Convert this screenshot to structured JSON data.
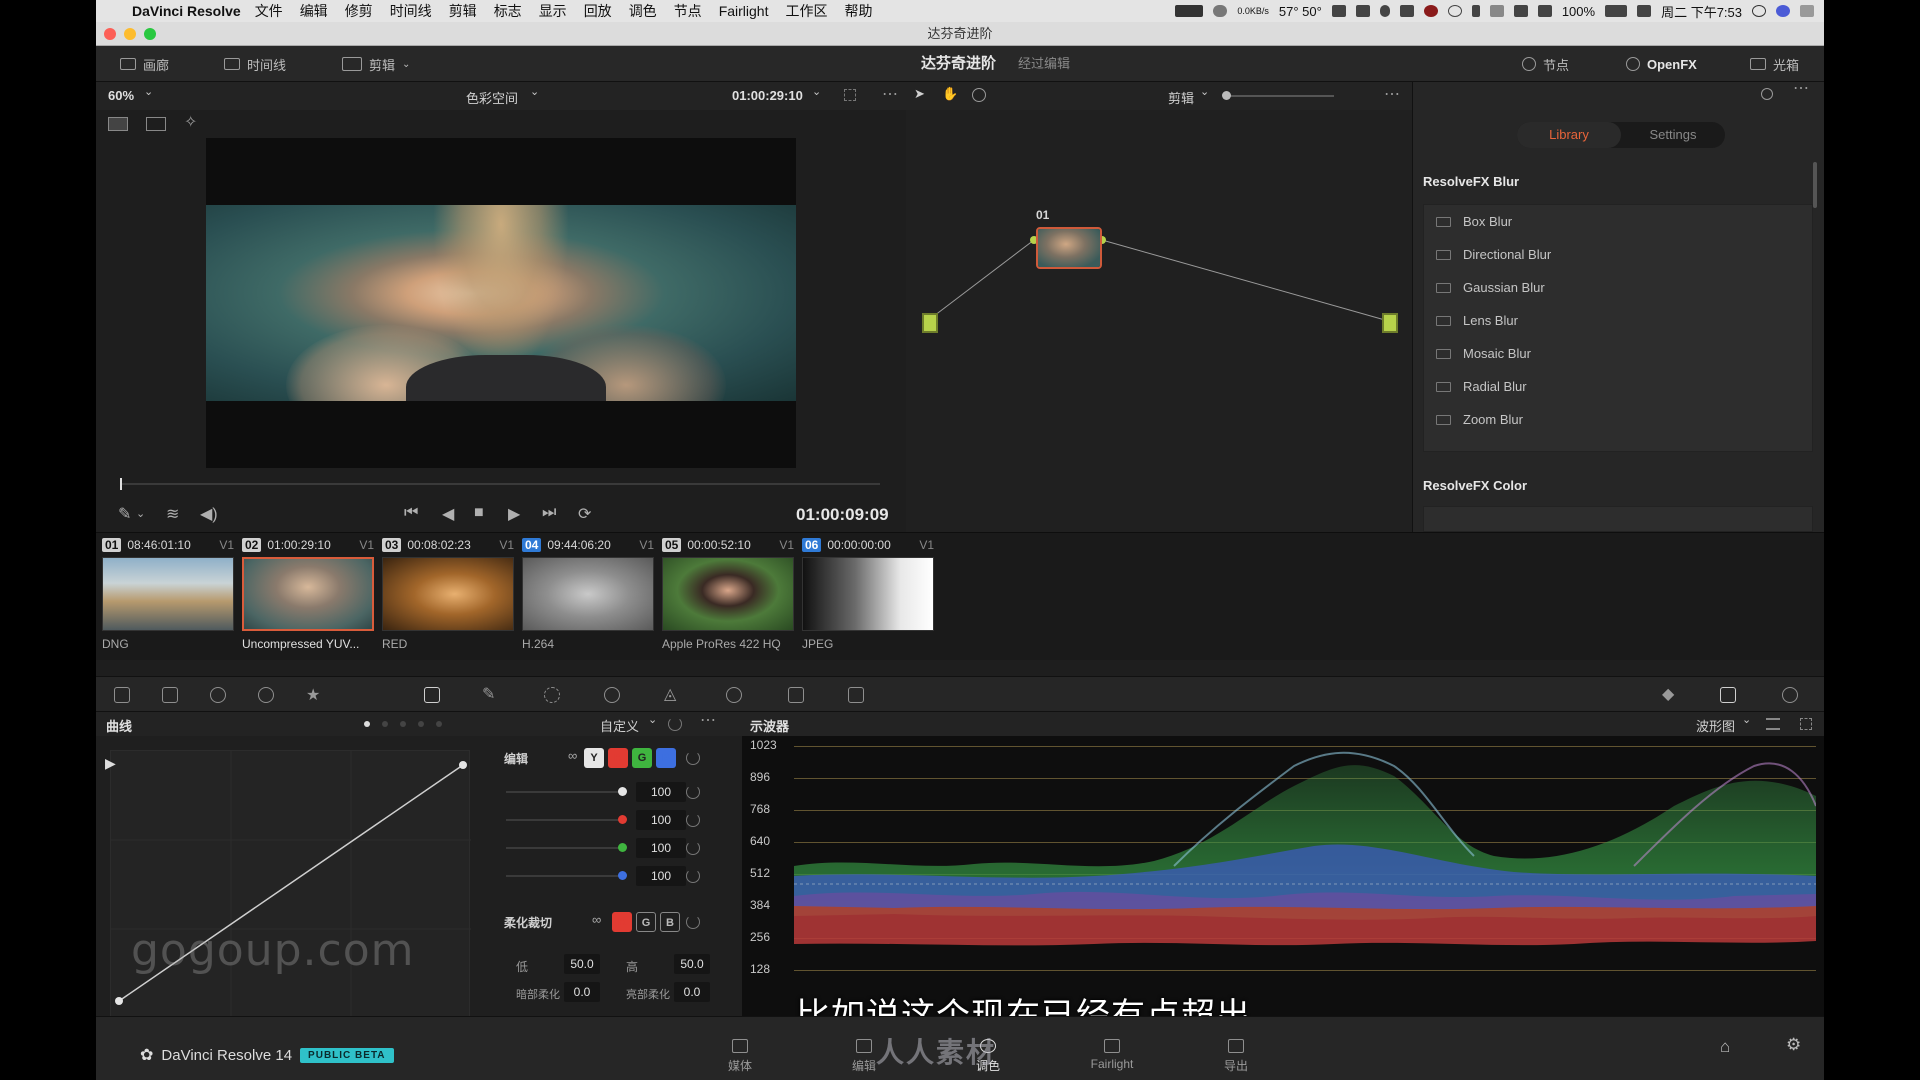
{
  "menubar": {
    "app_name": "DaVinci Resolve",
    "items": [
      "文件",
      "编辑",
      "修剪",
      "时间线",
      "剪辑",
      "标志",
      "显示",
      "回放",
      "调色",
      "节点",
      "Fairlight",
      "工作区",
      "帮助"
    ],
    "net_speed": "0.0KB/s",
    "temps": "57° 50°",
    "battery": "100%",
    "clock": "周二 下午7:53"
  },
  "window": {
    "title": "达芬奇进阶"
  },
  "topbar": {
    "left_buttons": [
      "画廊",
      "时间线",
      "剪辑"
    ],
    "project_title": "达芬奇进阶",
    "project_status": "经过编辑",
    "right_buttons": [
      "节点",
      "OpenFX",
      "光箱"
    ]
  },
  "viewer": {
    "zoom": "60%",
    "mode": "色彩空间",
    "timecode": "01:00:29:10",
    "playhead_timecode": "01:00:09:09",
    "playhead_position": 0.0
  },
  "node_editor": {
    "mode": "剪辑",
    "node_label": "01"
  },
  "openfx": {
    "tabs": [
      "Library",
      "Settings"
    ],
    "active_tab": "Library",
    "section_blur": "ResolveFX Blur",
    "blur_items": [
      "Box Blur",
      "Directional Blur",
      "Gaussian Blur",
      "Lens Blur",
      "Mosaic Blur",
      "Radial Blur",
      "Zoom Blur"
    ],
    "section_color": "ResolveFX Color"
  },
  "clips": [
    {
      "num": "01",
      "timecode": "08:46:01:10",
      "track": "V1",
      "name": "DNG",
      "selected": false
    },
    {
      "num": "02",
      "timecode": "01:00:29:10",
      "track": "V1",
      "name": "Uncompressed YUV...",
      "selected": true
    },
    {
      "num": "03",
      "timecode": "00:08:02:23",
      "track": "V1",
      "name": "RED",
      "selected": false
    },
    {
      "num": "04",
      "timecode": "09:44:06:20",
      "track": "V1",
      "name": "H.264",
      "selected": false
    },
    {
      "num": "05",
      "timecode": "00:00:52:10",
      "track": "V1",
      "name": "Apple ProRes 422 HQ",
      "selected": false
    },
    {
      "num": "06",
      "timecode": "00:00:00:00",
      "track": "V1",
      "name": "JPEG",
      "selected": false
    }
  ],
  "curves": {
    "title": "曲线",
    "preset": "自定义",
    "edit_label": "编辑",
    "channel_buttons": [
      "Y",
      "R",
      "G",
      "B"
    ],
    "intensity": [
      {
        "channel": "Y",
        "value": "100",
        "color": "#dddddd"
      },
      {
        "channel": "R",
        "value": "100",
        "color": "#e23b32"
      },
      {
        "channel": "G",
        "value": "100",
        "color": "#3fb53f"
      },
      {
        "channel": "B",
        "value": "100",
        "color": "#3d6fe0"
      }
    ],
    "soft_clip_label": "柔化裁切",
    "soft_clip_buttons": [
      "R",
      "G",
      "B"
    ],
    "low_label": "低",
    "low_value": "50.0",
    "high_label": "高",
    "high_value": "50.0",
    "low_soft_label": "暗部柔化",
    "low_soft_value": "0.0",
    "high_soft_label": "亮部柔化",
    "high_soft_value": "0.0"
  },
  "scope": {
    "title": "示波器",
    "type": "波形图",
    "scale_labels": [
      "1023",
      "896",
      "768",
      "640",
      "512",
      "384",
      "256",
      "128"
    ]
  },
  "watermark": "gogoup.com",
  "subtitle": "比如说这个现在已经有点超出",
  "bottom": {
    "brand": "DaVinci Resolve 14",
    "beta_badge": "PUBLIC BETA",
    "pages": [
      "媒体",
      "编辑",
      "调色",
      "Fairlight",
      "导出"
    ],
    "active_page": "调色",
    "logo_text": "人人素材"
  }
}
